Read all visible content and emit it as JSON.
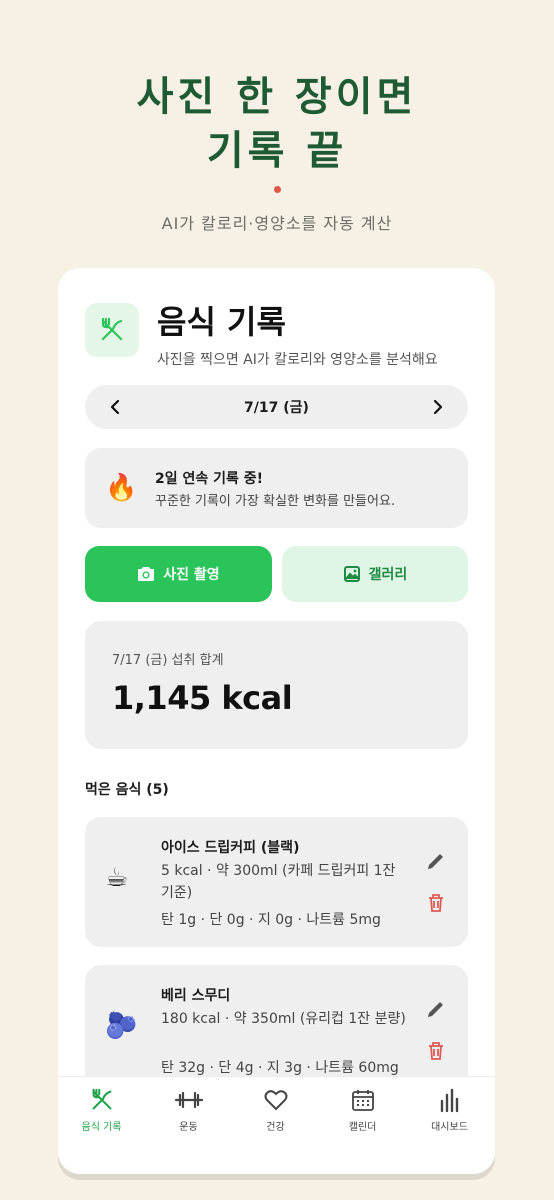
{
  "hero": {
    "title_line1": "사진 한 장이면",
    "title_line2": "기록 끝",
    "subtitle": "AI가 칼로리·영양소를 자동 계산"
  },
  "app": {
    "title": "음식 기록",
    "description": "사진을 찍으면 AI가 칼로리와 영양소를 분석해요",
    "date_label": "7/17 (금)",
    "streak_title": "2일 연속 기록 중!",
    "streak_desc": "꾸준한 기록이 가장 확실한 변화를 만들어요.",
    "camera_button": "사진 촬영",
    "gallery_button": "갤러리",
    "summary_label": "7/17 (금) 섭취 합계",
    "summary_value": "1,145 kcal",
    "list_title": "먹은 음식 (5)"
  },
  "foods": [
    {
      "name": "아이스 드립커피 (블랙)",
      "desc": "5 kcal · 약 300ml (카페 드립커피 1잔 기준)",
      "macro": "탄 1g · 단 0g · 지 0g · 나트륨 5mg",
      "emoji": "☕"
    },
    {
      "name": "베리 스무디",
      "desc": "180 kcal · 약 350ml (유리컵 1잔 분량)",
      "macro": "탄 32g · 단 4g · 지 3g · 나트륨 60mg",
      "emoji": "🫐"
    }
  ],
  "tabs": [
    {
      "label": "음식 기록",
      "icon": "utensils-icon",
      "active": true
    },
    {
      "label": "운동",
      "icon": "dumbbell-icon",
      "active": false
    },
    {
      "label": "건강",
      "icon": "heart-icon",
      "active": false
    },
    {
      "label": "캘린더",
      "icon": "calendar-icon",
      "active": false
    },
    {
      "label": "대시보드",
      "icon": "bar-chart-icon",
      "active": false
    }
  ],
  "colors": {
    "brand_green": "#2bc45a",
    "hero_green": "#1e5a34",
    "delete_red": "#e05a55",
    "background": "#f6f1e4"
  }
}
